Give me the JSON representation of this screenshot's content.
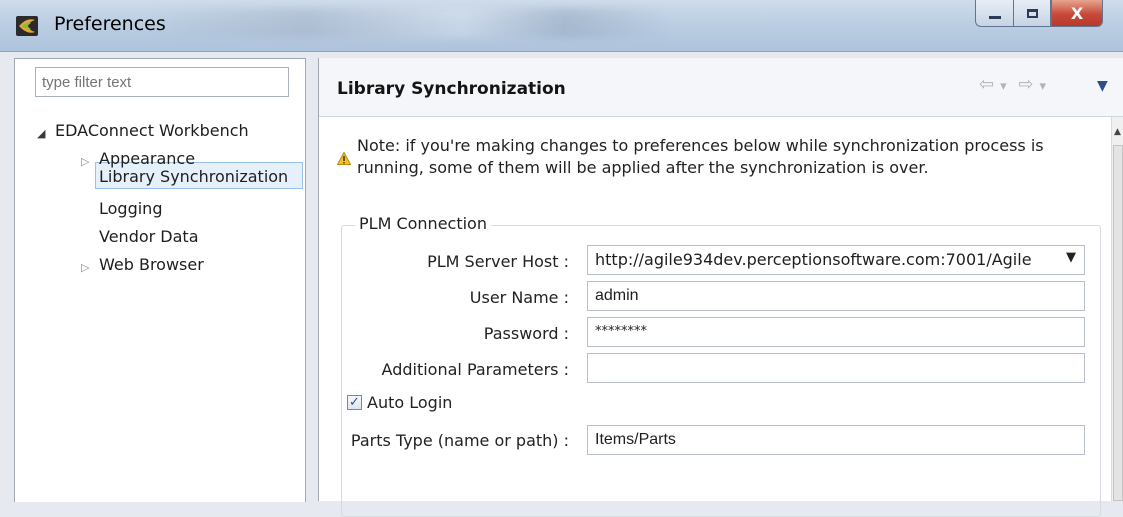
{
  "window": {
    "title": "Preferences",
    "buttons": {
      "minimize": "‒",
      "maximize": "▫",
      "close": "X"
    }
  },
  "sidebar": {
    "filter_placeholder": "type filter text",
    "root": "EDAConnect Workbench",
    "items": [
      {
        "label": "Appearance",
        "expandable": true
      },
      {
        "label": "Library Synchronization",
        "expandable": false,
        "selected": true
      },
      {
        "label": "Logging",
        "expandable": false
      },
      {
        "label": "Vendor Data",
        "expandable": false
      },
      {
        "label": "Web Browser",
        "expandable": true
      }
    ]
  },
  "page": {
    "title": "Library Synchronization",
    "nav": {
      "back": "⇦",
      "back_menu": "▾",
      "forward": "⇨",
      "forward_menu": "▾",
      "view_menu": "▼"
    },
    "note": "Note: if you're making changes to preferences below while synchronization process is running, some of them will be applied after the synchronization is over."
  },
  "plm": {
    "group_title": "PLM Connection",
    "server_host": {
      "label": "PLM Server Host :",
      "value": "http://agile934dev.perceptionsoftware.com:7001/Agile"
    },
    "user_name": {
      "label": "User Name :",
      "value": "admin"
    },
    "password": {
      "label": "Password :",
      "value": "********"
    },
    "additional_params": {
      "label": "Additional Parameters :",
      "value": ""
    },
    "auto_login": {
      "label": "Auto Login",
      "checked": "✓"
    },
    "parts_type": {
      "label": "Parts Type (name or path) :",
      "value": "Items/Parts"
    }
  },
  "colors": {
    "selection_bg": "#e6f0fb",
    "selection_border": "#9cc0e6",
    "close_button": "#c9483a",
    "titlebar": "#bccee3"
  }
}
